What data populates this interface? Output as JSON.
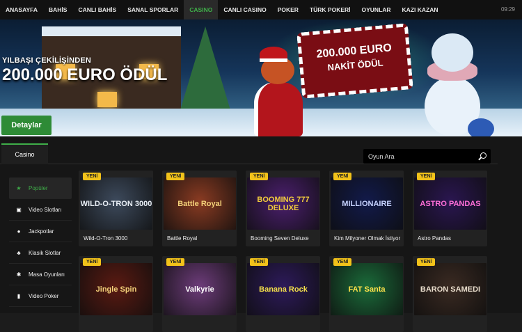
{
  "nav": {
    "items": [
      "ANASAYFA",
      "BAHİS",
      "CANLI BAHİS",
      "SANAL SPORLAR",
      "CASINO",
      "CANLI CASINO",
      "POKER",
      "TÜRK POKERİ",
      "OYUNLAR",
      "KAZI KAZAN"
    ],
    "active_index": 4,
    "clock": "09:29"
  },
  "hero": {
    "subtitle": "YILBAŞI ÇEKİLİŞİNDEN",
    "title": "200.000 EURO ÖDÜL",
    "button_label": "Detaylar",
    "sign_line1": "200.000 EURO",
    "sign_line2": "NAKİT ÖDÜL",
    "slide_count": 4,
    "active_slide": 2
  },
  "casino": {
    "tab_label": "Casino",
    "search_placeholder": "Oyun Ara",
    "sidebar": [
      {
        "label": "Popüler",
        "icon": "star-icon",
        "glyph": "★",
        "active": true
      },
      {
        "label": "Video Slotları",
        "icon": "slot-icon",
        "glyph": "▣",
        "active": false
      },
      {
        "label": "Jackpotlar",
        "icon": "bag-icon",
        "glyph": "●",
        "active": false
      },
      {
        "label": "Klasik Slotlar",
        "icon": "cherry-icon",
        "glyph": "♣",
        "active": false
      },
      {
        "label": "Masa Oyunları",
        "icon": "chip-icon",
        "glyph": "✱",
        "active": false
      },
      {
        "label": "Video Poker",
        "icon": "card-icon",
        "glyph": "▮",
        "active": false
      }
    ],
    "badge_label": "YENİ",
    "games": [
      {
        "name": "Wild-O-Tron 3000",
        "art": "WILD-O-TRON 3000",
        "bg": "#3d4a5c",
        "fg": "#e8eef5"
      },
      {
        "name": "Battle Royal",
        "art": "Battle Royal",
        "bg": "#8a3b22",
        "fg": "#f4d27a"
      },
      {
        "name": "Booming Seven Deluxe",
        "art": "BOOMING 777 DELUXE",
        "bg": "#4b1f6e",
        "fg": "#f2cc3c"
      },
      {
        "name": "Kim Milyoner Olmak İstiyor",
        "art": "MILLIONAIRE",
        "bg": "#121a4a",
        "fg": "#c7d3ff"
      },
      {
        "name": "Astro Pandas",
        "art": "ASTRO PANDAS",
        "bg": "#2a1650",
        "fg": "#ff6fd8"
      },
      {
        "name": "",
        "art": "Jingle Spin",
        "bg": "#5a1a12",
        "fg": "#f4d27a"
      },
      {
        "name": "",
        "art": "Valkyrie",
        "bg": "#6d3c7a",
        "fg": "#ffffff"
      },
      {
        "name": "",
        "art": "Banana Rock",
        "bg": "#2d1a5a",
        "fg": "#f4e04a"
      },
      {
        "name": "",
        "art": "FAT Santa",
        "bg": "#1b6b3a",
        "fg": "#ffe24a"
      },
      {
        "name": "",
        "art": "BARON SAMEDI",
        "bg": "#3a2a22",
        "fg": "#e8dccb"
      }
    ]
  }
}
